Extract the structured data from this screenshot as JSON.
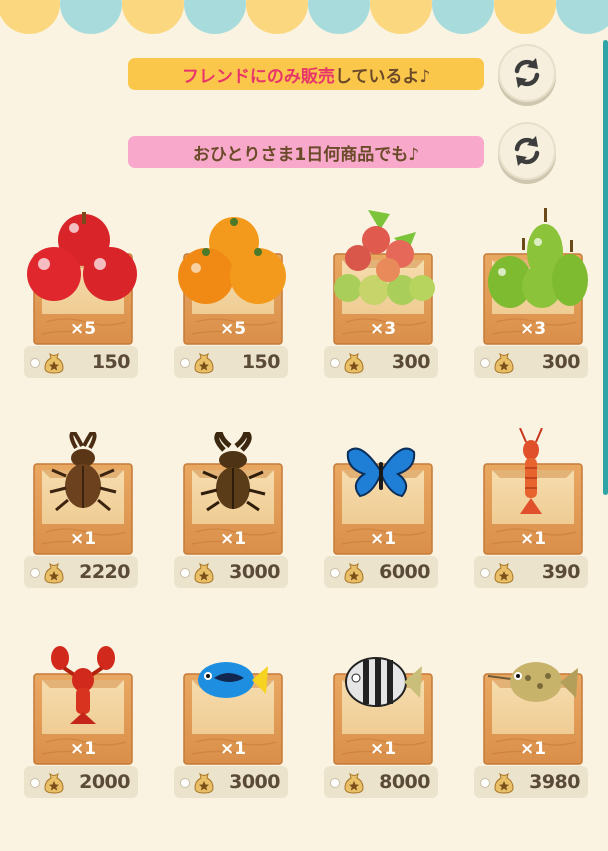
{
  "banners": {
    "friend_only_highlight": "フレンドにのみ販売",
    "friend_only_rest": "しているよ♪",
    "per_person": "おひとりさま1日何商品でも♪"
  },
  "icons": {
    "refresh": "refresh-arrows-icon",
    "currency": "bell-bag-icon"
  },
  "colors": {
    "banner_yellow": "#fbc74b",
    "banner_pink": "#f8a9cb",
    "highlight_text": "#e8356a",
    "background": "#faf3e1"
  },
  "items": [
    {
      "name": "apple",
      "qty": "×5",
      "price": "150"
    },
    {
      "name": "orange",
      "qty": "×5",
      "price": "150"
    },
    {
      "name": "lychee",
      "qty": "×3",
      "price": "300"
    },
    {
      "name": "pear",
      "qty": "×3",
      "price": "300"
    },
    {
      "name": "stag-beetle",
      "qty": "×1",
      "price": "2220"
    },
    {
      "name": "giant-stag-beetle",
      "qty": "×1",
      "price": "3000"
    },
    {
      "name": "blue-butterfly",
      "qty": "×1",
      "price": "6000"
    },
    {
      "name": "shrimp",
      "qty": "×1",
      "price": "390"
    },
    {
      "name": "lobster",
      "qty": "×1",
      "price": "2000"
    },
    {
      "name": "blue-tang-fish",
      "qty": "×1",
      "price": "3000"
    },
    {
      "name": "striped-fish",
      "qty": "×1",
      "price": "8000"
    },
    {
      "name": "pufferfish",
      "qty": "×1",
      "price": "3980"
    }
  ]
}
